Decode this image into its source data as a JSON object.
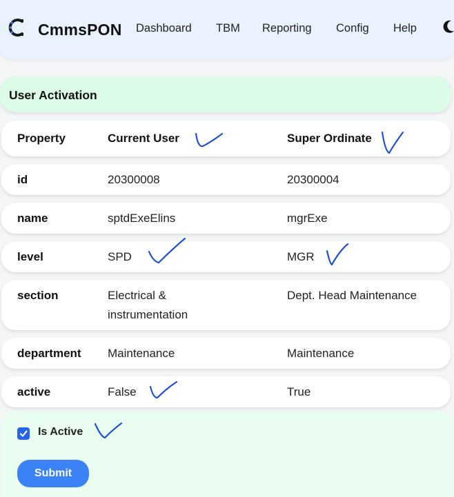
{
  "app": {
    "name": "CmmsPON",
    "logo_icon": "gear-c-logo-icon",
    "theme_toggle_icon": "moon-icon"
  },
  "nav": {
    "items": [
      "Dashboard",
      "TBM",
      "Reporting",
      "Config",
      "Help"
    ]
  },
  "section": {
    "title": "User Activation"
  },
  "table": {
    "columns": [
      "Property",
      "Current User",
      "Super Ordinate"
    ],
    "rows": [
      {
        "property": "id",
        "current": "20300008",
        "super": "20300004"
      },
      {
        "property": "name",
        "current": "sptdExeElins",
        "super": "mgrExe"
      },
      {
        "property": "level",
        "current": "SPD",
        "super": "MGR"
      },
      {
        "property": "section",
        "current": "Electrical & instrumentation",
        "super": "Dept. Head Maintenance"
      },
      {
        "property": "department",
        "current": "Maintenance",
        "super": "Maintenance"
      },
      {
        "property": "active",
        "current": "False",
        "super": "True"
      }
    ]
  },
  "form": {
    "checkbox_label": "Is Active",
    "checkbox_checked": true,
    "submit_label": "Submit"
  },
  "colors": {
    "navbar_bg": "#eaf2ff",
    "section_header_bg": "#dcfce7",
    "form_bg": "#e9fdf0",
    "accent": "#3b82f6",
    "checkbox": "#2563eb",
    "handwritten_mark": "#1d4ed8"
  }
}
